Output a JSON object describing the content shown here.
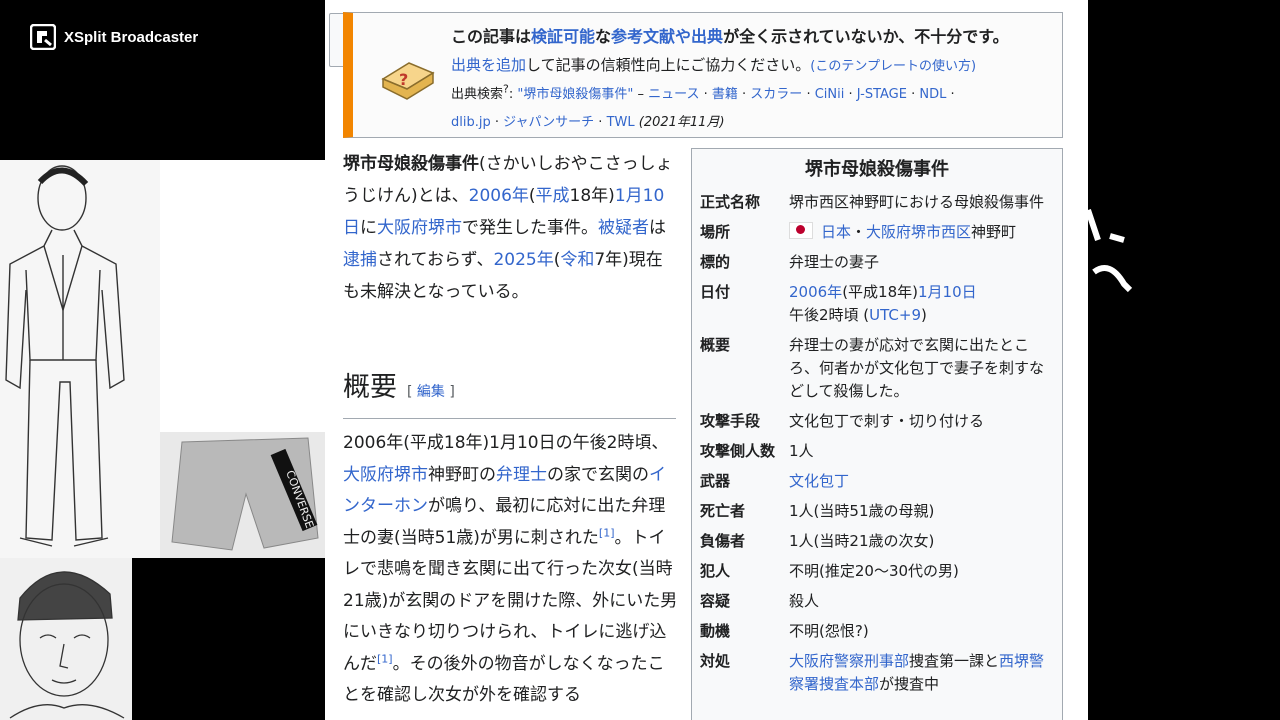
{
  "watermark": {
    "text": "XSplit Broadcaster",
    "icon": "xsplit-logo-icon"
  },
  "left_images": {
    "sketch_full": "full-body-sketch",
    "shorts": {
      "brand_text": "CONVERSE"
    },
    "sketch_face": "face-sketch"
  },
  "page": {
    "menu_icon": "hamburger-menu-icon",
    "ambox": {
      "line1_a": "この記事は",
      "line1_link1": "検証可能",
      "line1_b": "な",
      "line1_link2": "参考文献や出典",
      "line1_c": "が全く示されていないか、不十分です。",
      "line2_link": "出典を追加",
      "line2_text": "して記事の信頼性向上にご協力ください。",
      "line2_paren_link": "(このテンプレートの使い方)",
      "search_label": "出典検索",
      "search_sup": "?",
      "search_colon": ": ",
      "search_query": "\"堺市母娘殺傷事件\"",
      "search_links": [
        "ニュース",
        "書籍",
        "スカラー",
        "CiNii",
        "J-STAGE",
        "NDL",
        "dlib.jp",
        "ジャパンサーチ",
        "TWL"
      ],
      "date": "(2021年11月)"
    },
    "lead": {
      "title": "堺市母娘殺傷事件",
      "reading": "(さかいしおやこさっしょうじけん)とは、",
      "year_link": "2006年",
      "paren_open": "(",
      "era_link": "平成",
      "era_year": "18年)",
      "date_link": "1月10日",
      "ni": "に",
      "place_link": "大阪府堺市",
      "occurred": "で発生した事件。",
      "suspect_link": "被疑者",
      "wa": "は",
      "arrest_link": "逮捕",
      "not_yet": "されておらず、",
      "year2_link": "2025年",
      "paren2": "(",
      "era2_link": "令和",
      "era2_year": "7年)現在も未解決となっている。"
    },
    "section": {
      "title": "概要",
      "edit_open": "[ ",
      "edit_link": "編集",
      "edit_close": " ]"
    },
    "para": {
      "t1": "2006年(平成18年)1月10日の午後2時頃、",
      "l1": "大阪府堺市",
      "t2": "神野町の",
      "l2": "弁理士",
      "t3": "の家で玄関の",
      "l3": "インターホン",
      "t4": "が鳴り、最初に応対に出た弁理士の妻(当時51歳)が男に刺された",
      "ref1": "[1]",
      "t5": "。トイレで悲鳴を聞き玄関に出て行った次女(当時21歳)が玄関のドアを開けた際、外にいた男にいきなり切りつけられ、トイレに逃げ込んだ",
      "ref2": "[1]",
      "t6": "。その後外の物音がしなくなったことを確認し次女が外を確認する"
    },
    "infobox": {
      "title": "堺市母娘殺傷事件",
      "rows": [
        {
          "k": "正式名称",
          "v": "堺市西区神野町における母娘殺傷事件"
        },
        {
          "k": "場所",
          "v_link1": "日本",
          "v_sep": "・",
          "v_link2": "大阪府堺市西区",
          "v_tail": "神野町"
        },
        {
          "k": "標的",
          "v": "弁理士の妻子"
        },
        {
          "k": "日付",
          "v_link1": "2006年",
          "v_mid": "(平成18年)",
          "v_link2": "1月10日",
          "v_line2a": "午後2時頃 (",
          "v_line2_link": "UTC+9",
          "v_line2b": ")"
        },
        {
          "k": "概要",
          "v": "弁理士の妻が応対で玄関に出たところ、何者かが文化包丁で妻子を刺すなどして殺傷した。"
        },
        {
          "k": "攻撃手段",
          "v": "文化包丁で刺す・切り付ける"
        },
        {
          "k": "攻撃側人数",
          "v": "1人"
        },
        {
          "k": "武器",
          "v_link": "文化包丁"
        },
        {
          "k": "死亡者",
          "v": "1人(当時51歳の母親)"
        },
        {
          "k": "負傷者",
          "v": "1人(当時21歳の次女)"
        },
        {
          "k": "犯人",
          "v": "不明(推定20〜30代の男)"
        },
        {
          "k": "容疑",
          "v": "殺人"
        },
        {
          "k": "動機",
          "v": "不明(怨恨?)"
        },
        {
          "k": "対処",
          "v_link1": "大阪府警察刑事部",
          "v_mid": "捜査第一課と",
          "v_link2": "西堺警察署捜査本部",
          "v_tail": "が捜査中"
        }
      ]
    }
  }
}
